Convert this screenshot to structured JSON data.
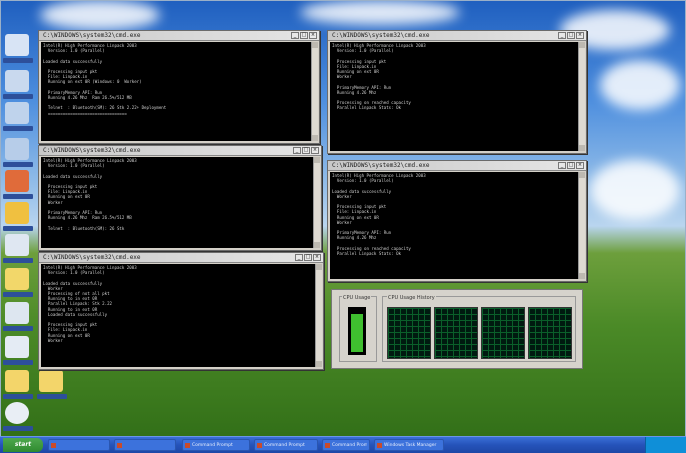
{
  "taskbar": {
    "start_label": "start",
    "tasks": [
      {
        "label": ""
      },
      {
        "label": ""
      },
      {
        "label": "Command Prompt"
      },
      {
        "label": "Command Prompt"
      },
      {
        "label": "Command Prompt"
      },
      {
        "label": "Windows Task Manager"
      }
    ]
  },
  "windows": [
    {
      "title": "C:\\WINDOWS\\system32\\cmd.exe",
      "lines": [
        "Intel(R) High Performance Linpack 2003",
        "  Version: 1.0 (Parallel)",
        "",
        "Loaded data successfully",
        "",
        "  Processing input pkt",
        "  File: Linpack.in",
        "  Running on ext 0R (Windows: 0  Worker)",
        "",
        "  PrimaryMemory API: Run",
        "  Running 4.26 Mhz  Ram 26.5%/512 MB",
        "",
        "  Telnet  : Bluetooth(SM): 26 Stk 2.22+ Deployment ",
        "  ================================"
      ]
    },
    {
      "title": "C:\\WINDOWS\\system32\\cmd.exe",
      "lines": [
        "Intel(R) High Performance Linpack 2003",
        "  Version: 1.0 (Parallel)",
        "",
        "  Processing input pkt",
        "  File: Linpack.in",
        "  Running on ext 0R",
        "  Worker",
        "",
        "  PrimaryMemory API: Run",
        "  Running 4.26 Mhz",
        "",
        "  Processing on reached capacity",
        "  Parallel Linpack Stats: Ok"
      ]
    },
    {
      "title": "C:\\WINDOWS\\system32\\cmd.exe",
      "lines": [
        "Intel(R) High Performance Linpack 2003",
        "  Version: 1.0 (Parallel)",
        "",
        "Loaded data successfully",
        "",
        "  Processing input pkt",
        "  File: Linpack.in",
        "  Running on ext 0R",
        "  Worker",
        "",
        "  PrimaryMemory API: Run",
        "  Running 4.26 Mhz  Ram 26.5%/512 MB",
        "",
        "  Telnet  : Bluetooth(SM): 26 Stk"
      ]
    },
    {
      "title": "C:\\WINDOWS\\system32\\cmd.exe",
      "lines": [
        "Intel(R) High Performance Linpack 2003",
        "  Version: 1.0 (Parallel)",
        "",
        "Loaded data successfully",
        "  Worker",
        "",
        "  Processing input pkt",
        "  File: Linpack.in",
        "  Running on ext 0R",
        "  Worker",
        "",
        "  PrimaryMemory API: Run",
        "  Running 4.26 Mhz",
        "",
        "  Processing on reached capacity",
        "  Parallel Linpack Stats: Ok"
      ]
    },
    {
      "title": "C:\\WINDOWS\\system32\\cmd.exe",
      "lines": [
        "Intel(R) High Performance Linpack 2003",
        "  Version: 1.0 (Parallel)",
        "",
        "Loaded data successfully",
        "  Worker",
        "  Processing of not all pkt",
        "  Running to in ext 0R",
        "  Parallel Linpack: Stk 2.22",
        "  Running to in ext 0R",
        "  Loaded data successfully",
        "",
        "  Processing input pkt",
        "  File: Linpack.in",
        "  Running on ext 0R",
        "  Worker"
      ]
    }
  ],
  "perf": {
    "cpu_usage_label": "CPU Usage",
    "history_label": "CPU Usage History",
    "cpu_usage_level": 0.9,
    "cpu_cores": 4
  }
}
